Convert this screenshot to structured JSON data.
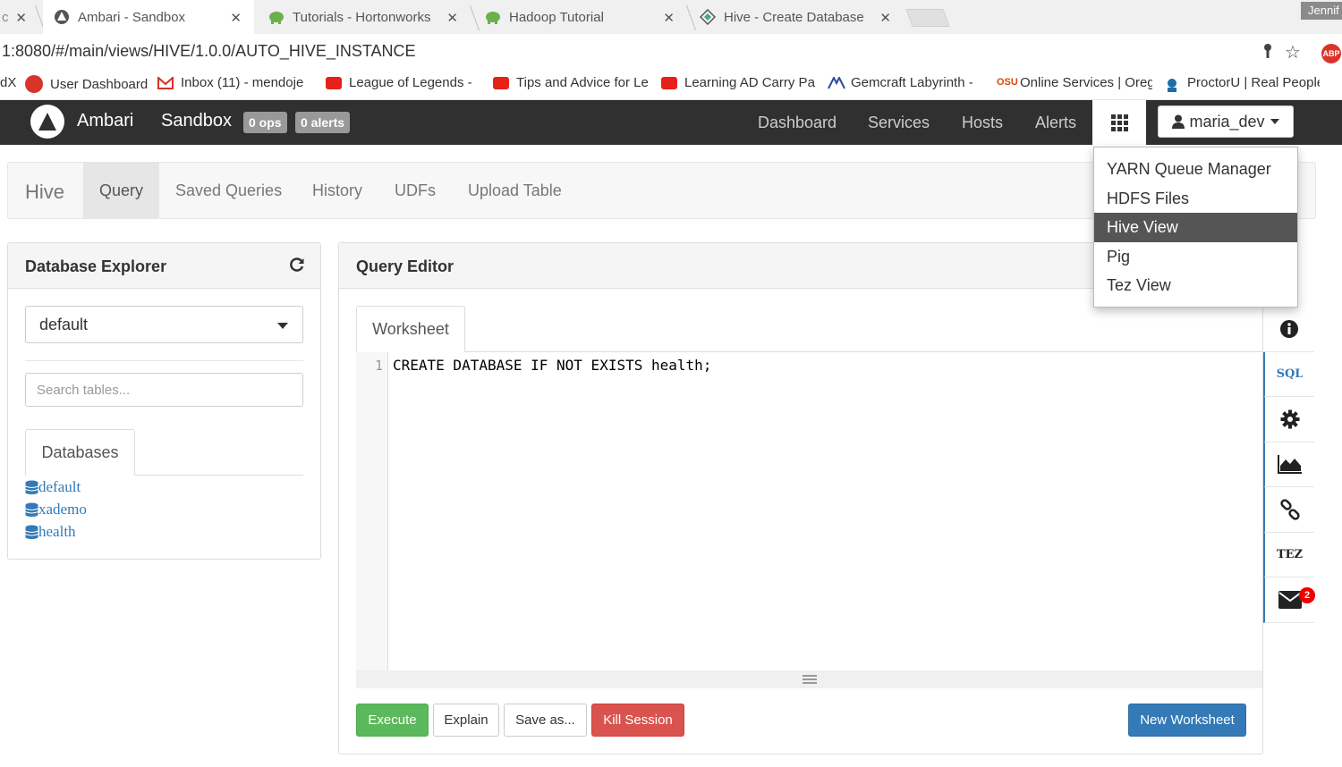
{
  "browser": {
    "tabs": [
      {
        "title": "",
        "partial": "c"
      },
      {
        "title": "Ambari - Sandbox"
      },
      {
        "title": "Tutorials - Hortonworks"
      },
      {
        "title": "Hadoop Tutorial"
      },
      {
        "title": "Hive - Create Database"
      }
    ],
    "profile_name": "Jennif",
    "url": "1:8080/#/main/views/HIVE/1.0.0/AUTO_HIVE_INSTANCE",
    "abp_label": "ABP",
    "bookmarks": [
      {
        "label": "dX",
        "icon_color": "#ffffff"
      },
      {
        "label": "User Dashboard",
        "icon_color": "#d9342b"
      },
      {
        "label": "Inbox (11) - mendoje",
        "icon_color": "#d93025"
      },
      {
        "label": "League of Legends - ",
        "icon_color": "#e62117"
      },
      {
        "label": "Tips and Advice for Le",
        "icon_color": "#e62117"
      },
      {
        "label": "Learning AD Carry Pa",
        "icon_color": "#e62117"
      },
      {
        "label": "Gemcraft Labyrinth - ",
        "icon_color": "#2b4c9e"
      },
      {
        "label": "Online Services | Oreg",
        "icon_color": "#dc4405"
      },
      {
        "label": "ProctorU | Real People",
        "icon_color": "#1d6fa5"
      }
    ]
  },
  "nav": {
    "brand": "Ambari",
    "cluster": "Sandbox",
    "ops_badge": "0 ops",
    "alerts_badge": "0 alerts",
    "links": [
      "Dashboard",
      "Services",
      "Hosts",
      "Alerts"
    ],
    "user": "maria_dev"
  },
  "views_menu": {
    "items": [
      "YARN Queue Manager",
      "HDFS Files",
      "Hive View",
      "Pig",
      "Tez View"
    ],
    "active": "Hive View"
  },
  "hive_nav": {
    "brand": "Hive",
    "tabs": [
      "Query",
      "Saved Queries",
      "History",
      "UDFs",
      "Upload Table"
    ],
    "active": "Query"
  },
  "explorer": {
    "title": "Database Explorer",
    "selected_db": "default",
    "search_placeholder": "Search tables...",
    "tab_label": "Databases",
    "databases": [
      "default",
      "xademo",
      "health"
    ]
  },
  "query_editor": {
    "title": "Query Editor",
    "worksheet_tab": "Worksheet",
    "line_number": "1",
    "code": "CREATE DATABASE IF NOT EXISTS health;",
    "buttons": {
      "execute": "Execute",
      "explain": "Explain",
      "save_as": "Save as...",
      "kill_session": "Kill Session",
      "new_worksheet": "New Worksheet"
    }
  },
  "side_tools": {
    "sql_label": "SQL",
    "tez_label": "TEZ",
    "notification_count": "2"
  },
  "colors": {
    "nav_bg": "#303030",
    "link_blue": "#337ab7",
    "execute_green": "#5cb85c",
    "kill_red": "#d9534f"
  }
}
